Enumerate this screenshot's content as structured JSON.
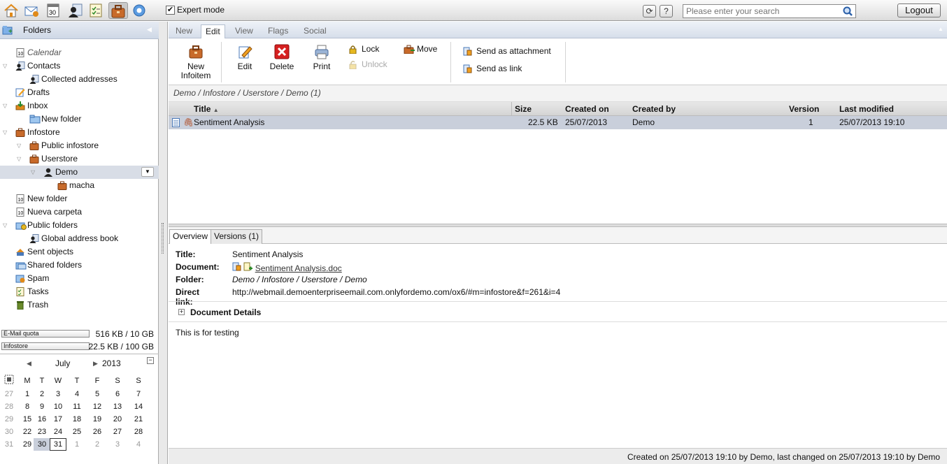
{
  "topbar": {
    "icons": [
      "home-icon",
      "mail-icon",
      "calendar-icon",
      "contacts-icon",
      "tasks-icon",
      "infostore-icon",
      "settings-icon"
    ],
    "expert_mode_label": "Expert mode",
    "expert_mode_checked": true,
    "search_placeholder": "Please enter your search",
    "logout_label": "Logout"
  },
  "folders": {
    "title": "Folders",
    "items": [
      {
        "label": "Calendar",
        "italic": true
      },
      {
        "label": "Contacts"
      },
      {
        "label": "Collected addresses"
      },
      {
        "label": "Drafts"
      },
      {
        "label": "Inbox"
      },
      {
        "label": "New folder"
      },
      {
        "label": "Infostore"
      },
      {
        "label": "Public infostore"
      },
      {
        "label": "Userstore"
      },
      {
        "label": "Demo",
        "selected": true
      },
      {
        "label": "macha"
      },
      {
        "label": "New folder"
      },
      {
        "label": "Nueva carpeta"
      },
      {
        "label": "Public folders"
      },
      {
        "label": "Global address book"
      },
      {
        "label": "Sent objects"
      },
      {
        "label": "Shared folders"
      },
      {
        "label": "Spam"
      },
      {
        "label": "Tasks"
      },
      {
        "label": "Trash"
      }
    ]
  },
  "quota": {
    "email_label": "E-Mail quota",
    "email_value": "516 KB / 10 GB",
    "infostore_label": "Infostore",
    "infostore_value": "22.5 KB / 100 GB"
  },
  "calendar": {
    "month": "July",
    "year": "2013",
    "weekdays": [
      "M",
      "T",
      "W",
      "T",
      "F",
      "S",
      "S"
    ],
    "weeks": [
      {
        "wk": "27",
        "days": [
          "1",
          "2",
          "3",
          "4",
          "5",
          "6",
          "7"
        ]
      },
      {
        "wk": "28",
        "days": [
          "8",
          "9",
          "10",
          "11",
          "12",
          "13",
          "14"
        ]
      },
      {
        "wk": "29",
        "days": [
          "15",
          "16",
          "17",
          "18",
          "19",
          "20",
          "21"
        ]
      },
      {
        "wk": "30",
        "days": [
          "22",
          "23",
          "24",
          "25",
          "26",
          "27",
          "28"
        ]
      },
      {
        "wk": "31",
        "days": [
          "29",
          "30",
          "31",
          "1",
          "2",
          "3",
          "4"
        ]
      }
    ],
    "selected_day": "30",
    "today": "31"
  },
  "tabs": [
    "New",
    "Edit",
    "View",
    "Flags",
    "Social"
  ],
  "active_tab": "Edit",
  "ribbon": {
    "new_infoitem": "New\nInfoitem",
    "edit": "Edit",
    "delete": "Delete",
    "print": "Print",
    "lock": "Lock",
    "unlock": "Unlock",
    "move": "Move",
    "send_attachment": "Send as attachment",
    "send_link": "Send as link"
  },
  "breadcrumb": "Demo / Infostore / Userstore / Demo (1)",
  "grid": {
    "headers": {
      "title": "Title",
      "size": "Size",
      "created_on": "Created on",
      "created_by": "Created by",
      "version": "Version",
      "last_modified": "Last modified"
    },
    "rows": [
      {
        "title": "Sentiment Analysis",
        "size": "22.5 KB",
        "created_on": "25/07/2013",
        "created_by": "Demo",
        "version": "1",
        "last_modified": "25/07/2013 19:10"
      }
    ]
  },
  "detail": {
    "tab_overview": "Overview",
    "tab_versions": "Versions (1)",
    "title_label": "Title:",
    "title_value": "Sentiment Analysis",
    "document_label": "Document:",
    "document_value": "Sentiment Analysis.doc",
    "folder_label": "Folder:",
    "folder_value": "Demo / Infostore / Userstore / Demo",
    "link_label": "Direct link:",
    "link_value": "http://webmail.demoenterpriseemail.com.onlyfordemo.com/ox6/#m=infostore&f=261&i=4",
    "details_toggle": "Document Details",
    "description": "This is for testing"
  },
  "footer": "Created on 25/07/2013 19:10 by Demo, last changed on 25/07/2013 19:10 by Demo"
}
